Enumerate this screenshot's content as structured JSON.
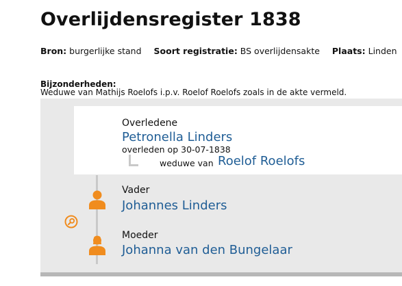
{
  "page": {
    "title": "Overlijdensregister 1838"
  },
  "meta": {
    "bron_label": "Bron:",
    "bron_value": "burgerlijke stand",
    "soort_label": "Soort registratie:",
    "soort_value": "BS overlijdensakte",
    "plaats_label": "Plaats:",
    "plaats_value": "Linden"
  },
  "bijzonderheden": {
    "label": "Bijzonderheden:",
    "text": "Weduwe van Mathijs Roelofs i.p.v. Roelof Roelofs zoals in de akte vermeld."
  },
  "deceased": {
    "role": "Overledene",
    "name": "Petronella Linders",
    "death_info": "overleden op 30-07-1838",
    "relation_label": "weduwe van",
    "spouse_name": "Roelof Roelofs"
  },
  "father": {
    "role": "Vader",
    "name": "Johannes Linders"
  },
  "mother": {
    "role": "Moeder",
    "name": "Johanna van den Bungelaar"
  },
  "colors": {
    "accent_orange": "#f08c1e",
    "link_blue": "#1f5d95",
    "panel_gray": "#e9e9e9"
  },
  "icons": {
    "person": "person-icon",
    "search": "magnifier-icon"
  }
}
